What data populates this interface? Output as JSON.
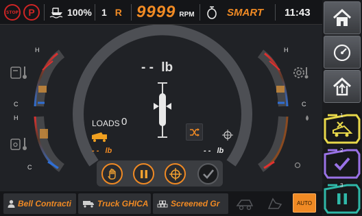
{
  "status_bar": {
    "stop_label": "STOP",
    "park_label": "P",
    "fuel_percent": "100%",
    "gear_number": "1",
    "gear_direction": "R",
    "rpm_value": "9999",
    "rpm_unit": "RPM",
    "mode": "SMART",
    "time": "11:43"
  },
  "gauges": {
    "left_top": {
      "high_label": "H",
      "low_label": "C",
      "icon": "oil-temperature-icon"
    },
    "left_bottom": {
      "high_label": "H",
      "low_label": "C",
      "icon": "hydraulic-temperature-icon"
    },
    "right_top": {
      "high_label": "H",
      "low_label": "C",
      "icon": "transmission-temperature-icon"
    },
    "right_bottom": {
      "icon": "fuel-level-icon"
    }
  },
  "payload": {
    "weight_value": "- -",
    "weight_unit": "lb",
    "loads_label": "LOADS",
    "loads_count": "0",
    "left_weight_value": "- -",
    "left_weight_unit": "lb",
    "right_weight_value": "- -",
    "right_weight_unit": "lb"
  },
  "controls": {
    "buttons": [
      "hand-stop-icon",
      "pause-icon",
      "crosshair-icon",
      "check-icon"
    ]
  },
  "side_panel": {
    "buttons": [
      "home-icon",
      "speedometer-icon",
      "upload-home-icon"
    ],
    "selectors": [
      {
        "number": "1",
        "icon": "dump-truck-cancel-icon",
        "color": "#e8d84a"
      },
      {
        "number": "2",
        "icon": "checkmark-icon",
        "color": "#9a72e6"
      },
      {
        "number": "3",
        "icon": "pause-icon",
        "color": "#2fb8a8"
      }
    ]
  },
  "bottom_bar": {
    "operator": "Bell Contracti",
    "truck": "Truck GHICA",
    "material": "Screened Gr",
    "auto_label": "AUTO"
  },
  "colors": {
    "accent": "#f08a24",
    "hot": "#e03030",
    "cold": "#2f6fd6"
  }
}
